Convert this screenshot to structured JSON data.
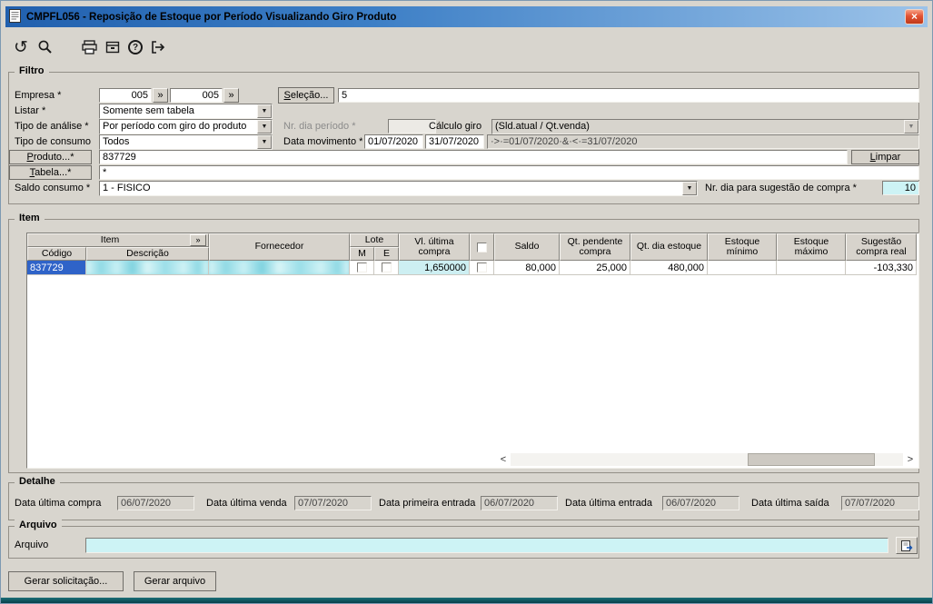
{
  "window": {
    "title": "CMPFL056 - Reposição de Estoque por Período Visualizando Giro Produto"
  },
  "icons": {
    "close": "×",
    "undo": "↺",
    "chevron_down": "▼",
    "expand": "»",
    "question": "?"
  },
  "toolbar": {
    "icons": [
      "undo-icon",
      "search-icon",
      "print-icon",
      "archive-icon",
      "help-icon",
      "exit-icon"
    ]
  },
  "filtro": {
    "legend": "Filtro",
    "empresa_label": "Empresa *",
    "empresa_code1": "005",
    "empresa_code2": "005",
    "selecao_button": "Seleção...",
    "empresa_value": "5",
    "listar_label": "Listar *",
    "listar_value": "Somente sem tabela",
    "tipo_analise_label": "Tipo de análise *",
    "tipo_analise_value": "Por período com giro do produto",
    "nr_dia_periodo_label": "Nr. dia período *",
    "nr_dia_periodo_value": "",
    "calculo_giro_label": "Cálculo giro",
    "calculo_giro_value": "(Sld.atual / Qt.venda)",
    "tipo_consumo_label": "Tipo de consumo",
    "tipo_consumo_value": "Todos",
    "data_movimento_label": "Data movimento *",
    "data_movimento_de": "01/07/2020",
    "data_movimento_ate": "31/07/2020",
    "data_movimento_expr": "·>·=01/07/2020·&·<·=31/07/2020",
    "produto_button": "Produto...*",
    "produto_value": "837729",
    "limpar_button": "Limpar",
    "tabela_button": "Tabela...*",
    "tabela_value": "*",
    "saldo_consumo_label": "Saldo consumo *",
    "saldo_consumo_value": "1 - FISICO",
    "sugestao_label": "Nr. dia para sugestão de compra *",
    "sugestao_value": "10"
  },
  "item": {
    "legend": "Item",
    "headers": {
      "item": "Item",
      "codigo": "Código",
      "descricao": "Descrição",
      "fornecedor": "Fornecedor",
      "lote": "Lote",
      "m": "M",
      "e": "E",
      "vl_ultima_compra": "Vl. última compra",
      "saldo": "Saldo",
      "qt_pendente_compra": "Qt. pendente compra",
      "qt_dia_estoque": "Qt. dia estoque",
      "estoque_minimo": "Estoque mínimo",
      "estoque_maximo": "Estoque máximo",
      "sugestao_compra_real": "Sugestão compra real"
    },
    "rows": [
      {
        "codigo": "837729",
        "descricao": "",
        "fornecedor": "",
        "lote_m": false,
        "lote_e": false,
        "vl_ultima_compra": "1,650000",
        "checked": false,
        "saldo": "80,000",
        "qt_pendente_compra": "25,000",
        "qt_dia_estoque": "480,000",
        "estoque_minimo": "",
        "estoque_maximo": "",
        "sugestao_compra_real": "-103,330"
      }
    ],
    "scroll_left": "<",
    "scroll_right": ">"
  },
  "detalhe": {
    "legend": "Detalhe",
    "fields": [
      {
        "label": "Data última compra",
        "value": "06/07/2020"
      },
      {
        "label": "Data última venda",
        "value": "07/07/2020"
      },
      {
        "label": "Data primeira entrada",
        "value": "06/07/2020"
      },
      {
        "label": "Data última entrada",
        "value": "06/07/2020"
      },
      {
        "label": "Data última saída",
        "value": "07/07/2020"
      }
    ]
  },
  "arquivo": {
    "legend": "Arquivo",
    "label": "Arquivo",
    "value": ""
  },
  "actions": {
    "gerar_solicitacao": "Gerar solicitação...",
    "gerar_arquivo": "Gerar arquivo"
  },
  "colors": {
    "window_bg": "#d8d5ce",
    "titlebar_blue": "#2160ae",
    "close_red": "#d5441d",
    "field_cyan": "#cdf3f5",
    "selection_blue": "#2f63c8",
    "bottom_edge_teal": "#0b5a64"
  }
}
